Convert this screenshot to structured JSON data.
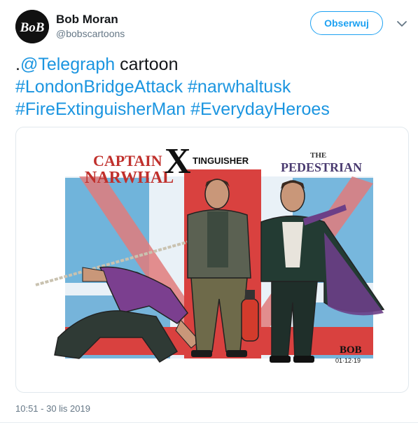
{
  "author": {
    "name": "Bob Moran",
    "handle": "@bobscartoons",
    "avatar_text": "BoB"
  },
  "follow_button": {
    "label": "Obserwuj"
  },
  "menu_icon": "chevron-down-icon",
  "tweet": {
    "prefix": ".",
    "mention": "@Telegraph",
    "after_mention": " cartoon",
    "hashtags": [
      "#LondonBridgeAttack",
      "#narwhaltusk",
      "#FireExtinguisherMan",
      "#EverydayHeroes"
    ]
  },
  "cartoon": {
    "title_left_line1": "CAPTAIN",
    "title_left_line2": "NARWHAL",
    "title_center_x": "X",
    "title_center": "TINGUISHER",
    "title_right_the": "THE",
    "title_right": "PEDESTRIAN",
    "signature": "BOB",
    "signature_date": "01·12·19"
  },
  "timestamp": "10:51 - 30 lis 2019",
  "colors": {
    "link": "#1b95e0",
    "accent": "#1da1f2",
    "flag_red": "#d9413f",
    "flag_blue": "#5aa9d6"
  }
}
